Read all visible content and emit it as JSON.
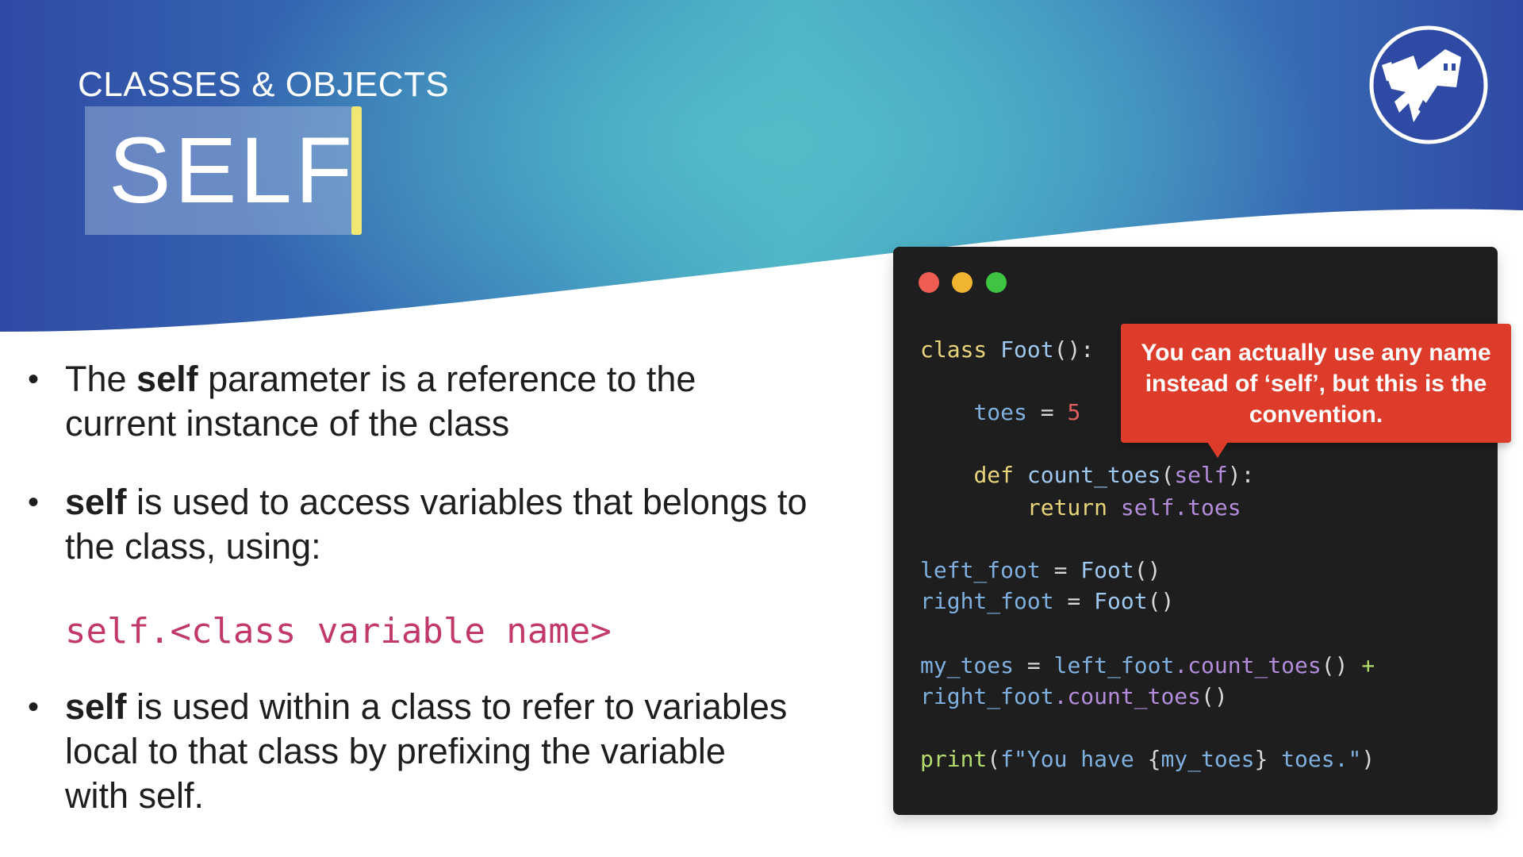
{
  "header": {
    "subtitle": "CLASSES & OBJECTS",
    "title": "SELF"
  },
  "bullets": [
    {
      "bold": "",
      "pre": "The ",
      "strong": "self",
      "line1_rest": " parameter is a reference to the",
      "line2": "current instance of the class"
    },
    {
      "strong": "self",
      "line1_rest": " is used to access variables that belongs to",
      "line2": "the class, using:"
    },
    {
      "strong": "self",
      "line1_rest": " is used within a class to refer to variables",
      "line2": "local to that class by prefixing the variable",
      "line3": "with self."
    }
  ],
  "code_sample": "self.<class variable name>",
  "code_window": {
    "lines": {
      "l1_kw": "class",
      "l1_name": "Foot",
      "l1_tail": "():",
      "l2_var": "toes",
      "l2_op": " = ",
      "l2_num": "5",
      "l3_kw": "def",
      "l3_fn": "count_toes",
      "l3_open": "(",
      "l3_self": "self",
      "l3_close": "):",
      "l4_kw": "return",
      "l4_self": "self",
      "l4_attr": ".toes",
      "l5_var": "left_foot",
      "l5_op": " = ",
      "l5_cls": "Foot",
      "l5_call": "()",
      "l6_var": "right_foot",
      "l6_op": " = ",
      "l6_cls": "Foot",
      "l6_call": "()",
      "l7_var": "my_toes",
      "l7_op": " = ",
      "l7_obj": "left_foot",
      "l7_meth": ".count_toes",
      "l7_call": "()",
      "l7_plus": " +",
      "l8_obj": "right_foot",
      "l8_meth": ".count_toes",
      "l8_call": "()",
      "l9_fn": "print",
      "l9_open": "(",
      "l9_str1": "f\"You have ",
      "l9_brace_open": "{",
      "l9_var": "my_toes",
      "l9_brace_close": "}",
      "l9_str2": " toes.\"",
      "l9_close": ")"
    }
  },
  "callout": {
    "text": "You can actually use any name instead of ‘self’, but this is the convention."
  },
  "colors": {
    "accent_yellow": "#f1e873",
    "callout_red": "#dd3c2a",
    "code_sample_pink": "#c2386b",
    "code_bg": "#1e1e1e"
  },
  "icons": {
    "logo": "knight-logo-icon"
  }
}
